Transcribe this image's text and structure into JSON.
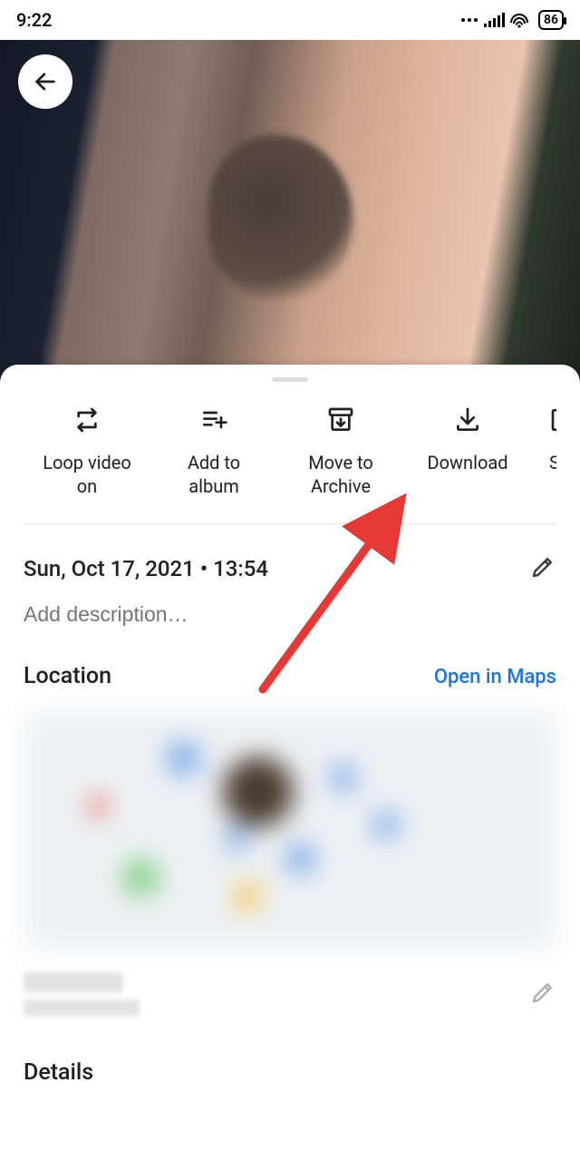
{
  "status": {
    "time": "9:22",
    "battery": "86"
  },
  "actions": [
    {
      "id": "loop",
      "label": "Loop video\non"
    },
    {
      "id": "album",
      "label": "Add to\nalbum"
    },
    {
      "id": "archive",
      "label": "Move to\nArchive"
    },
    {
      "id": "download",
      "label": "Download"
    },
    {
      "id": "slideshow",
      "label": "Slides"
    }
  ],
  "meta": {
    "datetime": "Sun, Oct 17, 2021  •  13:54",
    "description_placeholder": "Add description…"
  },
  "location": {
    "heading": "Location",
    "open_maps": "Open in Maps"
  },
  "details": {
    "heading": "Details"
  }
}
